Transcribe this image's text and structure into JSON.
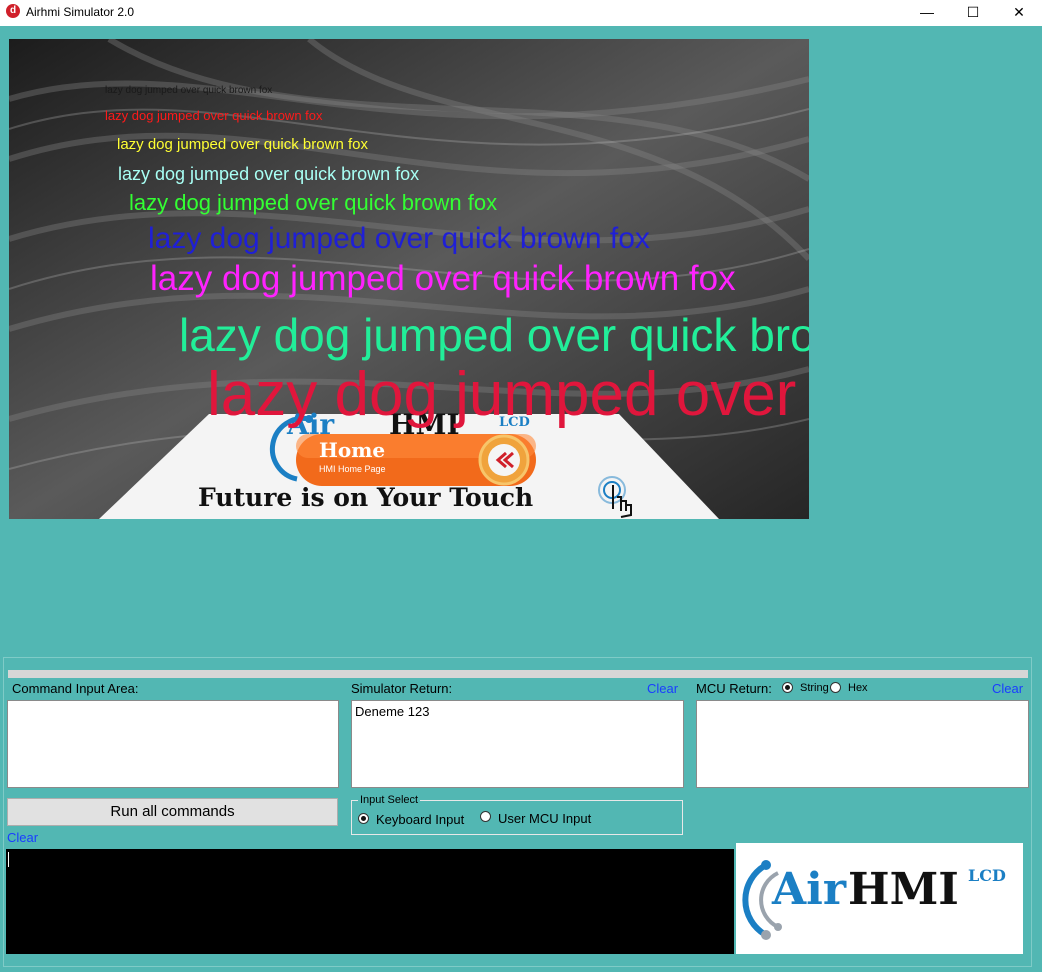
{
  "window": {
    "title": "Airhmi Simulator 2.0",
    "app_icon_letter": "d",
    "minimize_glyph": "—",
    "maximize_glyph": "☐",
    "close_glyph": "✕"
  },
  "screen": {
    "demo_lines": [
      {
        "text": "lazy dog jumped over quick brown fox",
        "color": "#1a1a1a"
      },
      {
        "text": "lazy dog jumped over quick brown fox",
        "color": "#ff1a1a"
      },
      {
        "text": "lazy dog jumped over quick brown fox",
        "color": "#ffff33"
      },
      {
        "text": "lazy dog jumped over quick brown fox",
        "color": "#a8fff4"
      },
      {
        "text": "lazy dog jumped over quick brown fox",
        "color": "#33ff33"
      },
      {
        "text": "lazy dog jumped over quick brown fox",
        "color": "#1f1fd6"
      },
      {
        "text": "lazy dog jumped over quick brown fox",
        "color": "#ff22ff"
      },
      {
        "text": "lazy dog jumped over quick brown fox",
        "color": "#22ee99"
      },
      {
        "text": "lazy dog jumped over quick brown fox",
        "color": "#e0163c"
      }
    ],
    "logo_air": "Air",
    "logo_hmi": "HMI",
    "logo_lcd": "LCD",
    "home_button": {
      "title": "Home",
      "subtitle": "HMI Home Page",
      "icon": "double-chevron-left-icon"
    },
    "tagline": "Future is on Your Touch",
    "tap_icon": "hand-tap-icon"
  },
  "panel": {
    "command_input_label": "Command Input Area:",
    "command_input_value": "",
    "simulator_return_label": "Simulator Return:",
    "simulator_return_value": "Deneme 123",
    "clear_label": "Clear",
    "mcu_return_label": "MCU Return:",
    "mcu_return_value": "",
    "mcu_format_options": [
      "String",
      "Hex"
    ],
    "mcu_format_selected": "String",
    "run_all_label": "Run all commands",
    "input_select": {
      "title": "Input Select",
      "options": [
        "Keyboard Input",
        "User MCU Input"
      ],
      "selected": "Keyboard Input"
    },
    "console_value": "",
    "logo": {
      "air": "Air",
      "hmi": "HMI",
      "lcd": "LCD"
    }
  },
  "colors": {
    "window_bg": "#52b7b3",
    "link": "#1a3dff",
    "home_orange": "#f26a1b",
    "brand_blue": "#1b7fc4",
    "brand_dark": "#111111",
    "brand_red": "#d0202a"
  }
}
